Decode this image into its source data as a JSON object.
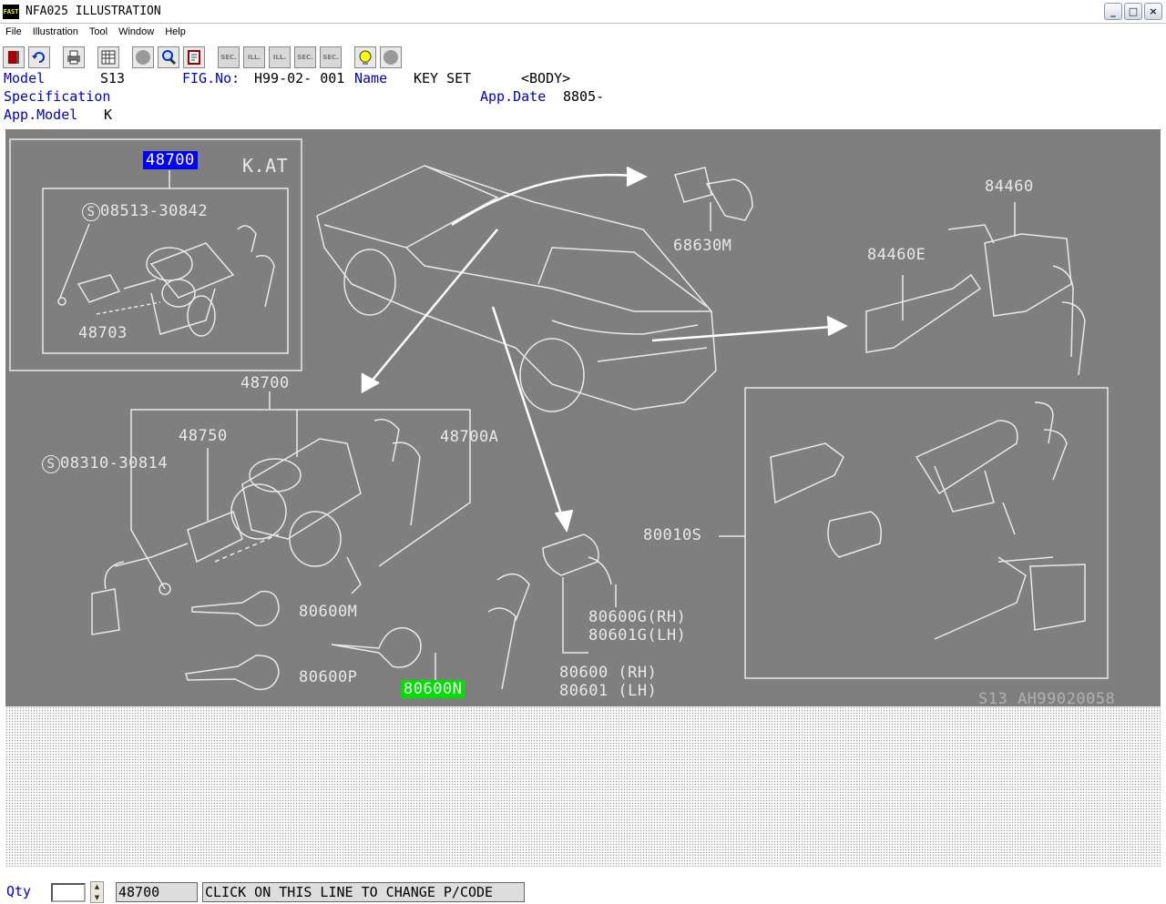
{
  "window": {
    "logo_text": "FAST",
    "title": "NFA025 ILLUSTRATION",
    "min": "_",
    "max": "□",
    "close": "×"
  },
  "menu": [
    "File",
    "Illustration",
    "Tool",
    "Window",
    "Help"
  ],
  "toolbar": {
    "sec_label": "SEC.",
    "ill_label": "ILL.",
    "help_label": "?"
  },
  "info": {
    "model_label": "Model",
    "model_value": "S13",
    "fig_label": "FIG.No:",
    "fig_value": "H99-02- 001",
    "name_label": "Name",
    "name_value": "KEY SET",
    "name_value2": "<BODY>",
    "spec_label": "Specification",
    "appdate_label": "App.Date",
    "appdate_value": "8805-",
    "appmodel_label": "App.Model",
    "appmodel_value": "K"
  },
  "illustration": {
    "parts": {
      "p48700_top": "48700",
      "kat": "K.AT",
      "p08513": "08513-30842",
      "p48703": "48703",
      "p48700_mid": "48700",
      "p48750": "48750",
      "p48700A": "48700A",
      "p08310": "08310-30814",
      "p80600M": "80600M",
      "p80600P": "80600P",
      "p80600N": "80600N",
      "p68630M": "68630M",
      "p84460": "84460",
      "p84460E": "84460E",
      "p80010S": "80010S",
      "p80600G": "80600G(RH)",
      "p80601G": "80601G(LH)",
      "p80600": "80600 (RH)",
      "p80601": "80601 (LH)",
      "drawing_id": "S13  AH99020058"
    }
  },
  "status": {
    "qty_label": "Qty",
    "spin_up": "▲",
    "spin_down": "▼",
    "pcode": "48700",
    "change_hint": "CLICK ON THIS LINE TO CHANGE P/CODE"
  },
  "colors": {
    "label_blue": "#0000cc",
    "illus_bg": "#7f7f7f",
    "sel_blue": "#0000ff",
    "sel_green": "#00e000"
  }
}
